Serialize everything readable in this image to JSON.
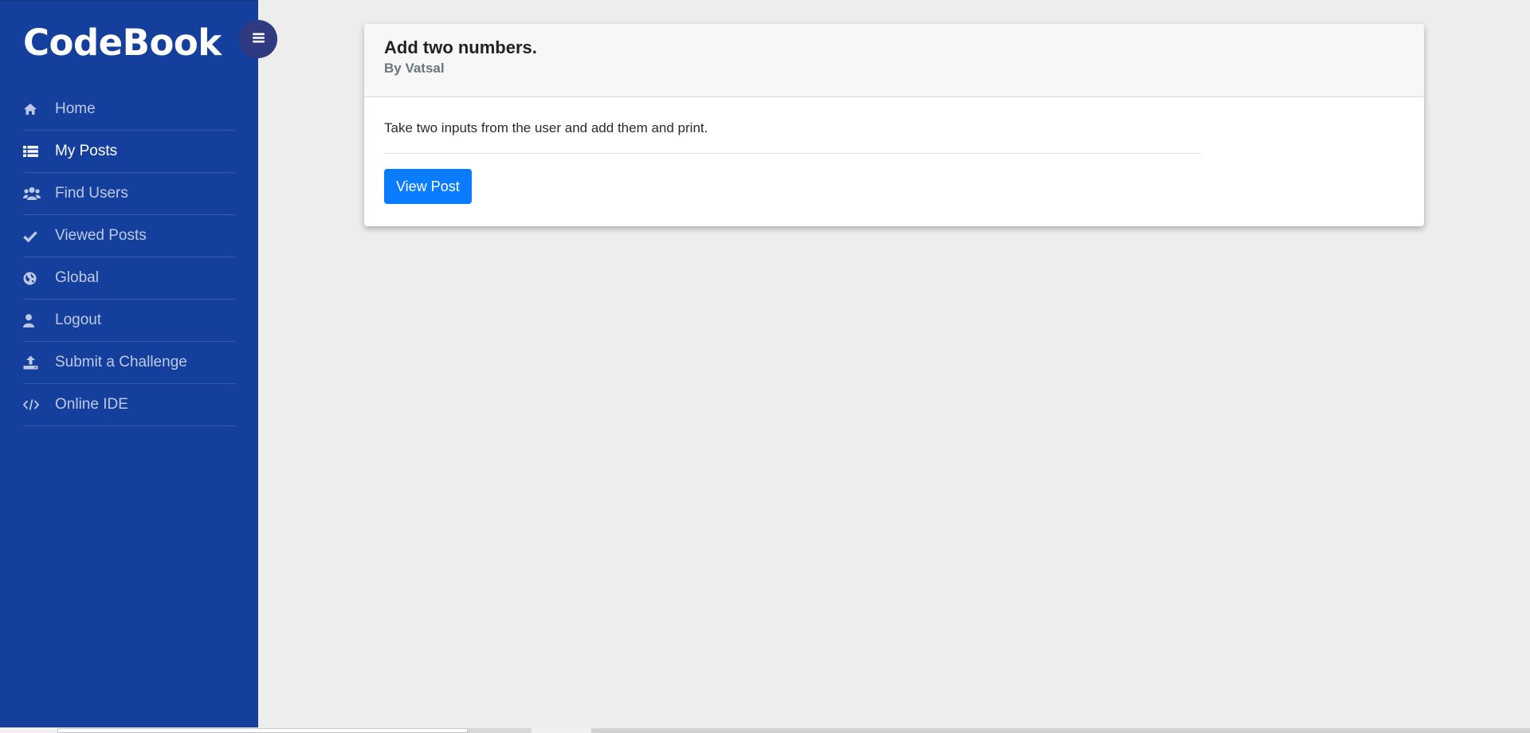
{
  "brand": {
    "title": "CodeBook"
  },
  "sidebar": {
    "items": [
      {
        "label": "Home",
        "icon": "home-icon",
        "active": false
      },
      {
        "label": "My Posts",
        "icon": "list-icon",
        "active": true
      },
      {
        "label": "Find Users",
        "icon": "users-icon",
        "active": false
      },
      {
        "label": "Viewed Posts",
        "icon": "check-icon",
        "active": false
      },
      {
        "label": "Global",
        "icon": "globe-icon",
        "active": false
      },
      {
        "label": "Logout",
        "icon": "user-icon",
        "active": false
      },
      {
        "label": "Submit a Challenge",
        "icon": "upload-icon",
        "active": false
      },
      {
        "label": "Online IDE",
        "icon": "code-icon",
        "active": false
      }
    ]
  },
  "toggle": {
    "icon": "menu-icon"
  },
  "post": {
    "title": "Add two numbers.",
    "author": "By Vatsal",
    "description": "Take two inputs from the user and add them and print.",
    "button_label": "View Post"
  },
  "colors": {
    "sidebar_bg": "#153f9d",
    "page_bg": "#ededed",
    "button_primary": "#0a7cff",
    "toggle_bg": "#2f3a80"
  }
}
